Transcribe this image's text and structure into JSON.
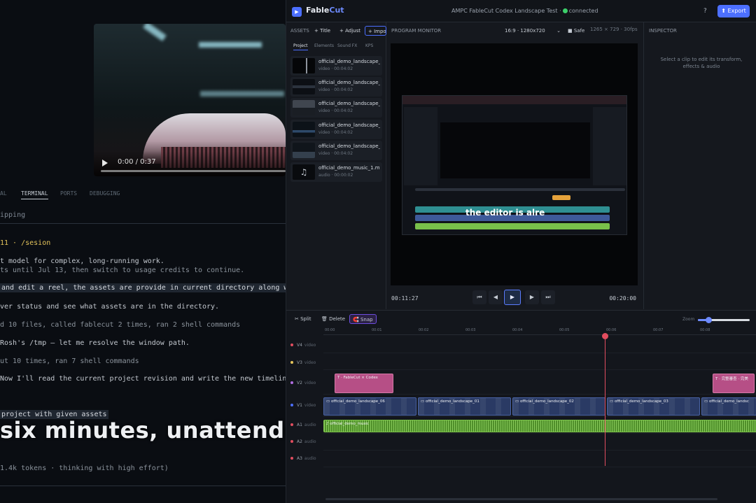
{
  "left": {
    "video": {
      "time": "0:00 / 0:37"
    },
    "terminal": {
      "tabs": [
        "TERMINAL",
        "PORTS",
        "DEBUGGING"
      ],
      "partial_tab": "AL",
      "status": "ipping",
      "lines": [
        {
          "text": "11 · /sesion",
          "style": "yel"
        },
        {
          "text": "t model for complex, long-running work.",
          "style": ""
        },
        {
          "text": "ts until Jul 13, then switch to usage credits to continue.",
          "style": ""
        },
        {
          "text": " and edit a reel, the assets are provide in current directory along with t",
          "style": "hl"
        },
        {
          "text": "ver status and see what assets are in the directory.",
          "style": ""
        },
        {
          "text": "d 10 files, called fablecut 2 times, ran 2 shell commands",
          "style": ""
        },
        {
          "text": "Rosh's /tmp — let me resolve the window path.",
          "style": ""
        },
        {
          "text": "ut 10 times, ran 7 shell commands",
          "style": ""
        },
        {
          "text": "Now I'll read the current project revision and write the new timeline:",
          "style": ""
        },
        {
          "text": " project with given assets",
          "style": "hl"
        },
        {
          "text": "1.4k tokens · thinking with high effort)",
          "style": ""
        }
      ]
    },
    "caption": "six minutes, unattended"
  },
  "editor": {
    "brand_main": "Fable",
    "brand_accent": "Cut",
    "logo_glyph": "▶",
    "project_title": "AMPC FableCut Codex Landscape Test ·",
    "connection": "connected",
    "help": "?",
    "export_label": "⬆ Export",
    "assets": {
      "heading": "ASSETS",
      "btn_title": "+ Title",
      "btn_adjust": "+ Adjust",
      "btn_import": "+ Impor",
      "tabs": [
        "Project",
        "Elements",
        "Sound FX",
        "KPS"
      ],
      "items": [
        {
          "name": "official_demo_landscape_",
          "meta": "video · 00:04:02"
        },
        {
          "name": "official_demo_landscape_",
          "meta": "video · 00:04:02"
        },
        {
          "name": "official_demo_landscape_",
          "meta": "video · 00:04:02"
        },
        {
          "name": "official_demo_landscape_",
          "meta": "video · 00:04:02"
        },
        {
          "name": "official_demo_landscape_",
          "meta": "video · 00:04:02"
        },
        {
          "name": "official_demo_music_1.m",
          "meta": "audio · 00:00:02"
        }
      ]
    },
    "monitor": {
      "heading": "PROGRAM MONITOR",
      "resolution": "16:9 · 1280x720",
      "safe_label": "Safe",
      "canvas_size": "1265 × 729 · 30fps",
      "nested_caption": "the editor is alre",
      "time_current": "00:11:27",
      "time_total": "00:20:00",
      "transport": [
        "⏮",
        "◀",
        "▶",
        "▶",
        "⏭"
      ]
    },
    "inspector": {
      "heading": "INSPECTOR",
      "hint": "Select a clip to edit its transform, effects & audio"
    },
    "timeline": {
      "tools": {
        "split": "✂ Split",
        "delete": "🗑 Delete",
        "snap": "🧲 Snap"
      },
      "zoom_label": "Zoom",
      "zoom_level": 0.2,
      "ruler": [
        "00:00",
        "00:01",
        "00:02",
        "00:03",
        "00:04",
        "00:05",
        "00:06",
        "00:07",
        "00:08"
      ],
      "tracks": [
        {
          "id": "V4",
          "kind": "video",
          "color": "#e24d5f"
        },
        {
          "id": "V3",
          "kind": "video",
          "color": "#e5c55b"
        },
        {
          "id": "V2",
          "kind": "video",
          "color": "#b06de0"
        },
        {
          "id": "V1",
          "kind": "video",
          "color": "#4c6fff"
        },
        {
          "id": "A1",
          "kind": "audio",
          "color": "#e24d5f"
        },
        {
          "id": "A2",
          "kind": "audio",
          "color": "#e24d5f"
        },
        {
          "id": "A3",
          "kind": "audio",
          "color": "#e24d5f"
        }
      ],
      "title_clips": [
        "T · FableCut × Codex",
        "T · 完整審查 · 完美"
      ],
      "video_clips": [
        "▭ official_demo_landscape_06",
        "▭ official_demo_landscape_01",
        "▭ official_demo_landscape_02",
        "▭ official_demo_landscape_03",
        "▭ official_demo_landsc"
      ],
      "audio_clip": "♪ official_demo_music"
    }
  }
}
